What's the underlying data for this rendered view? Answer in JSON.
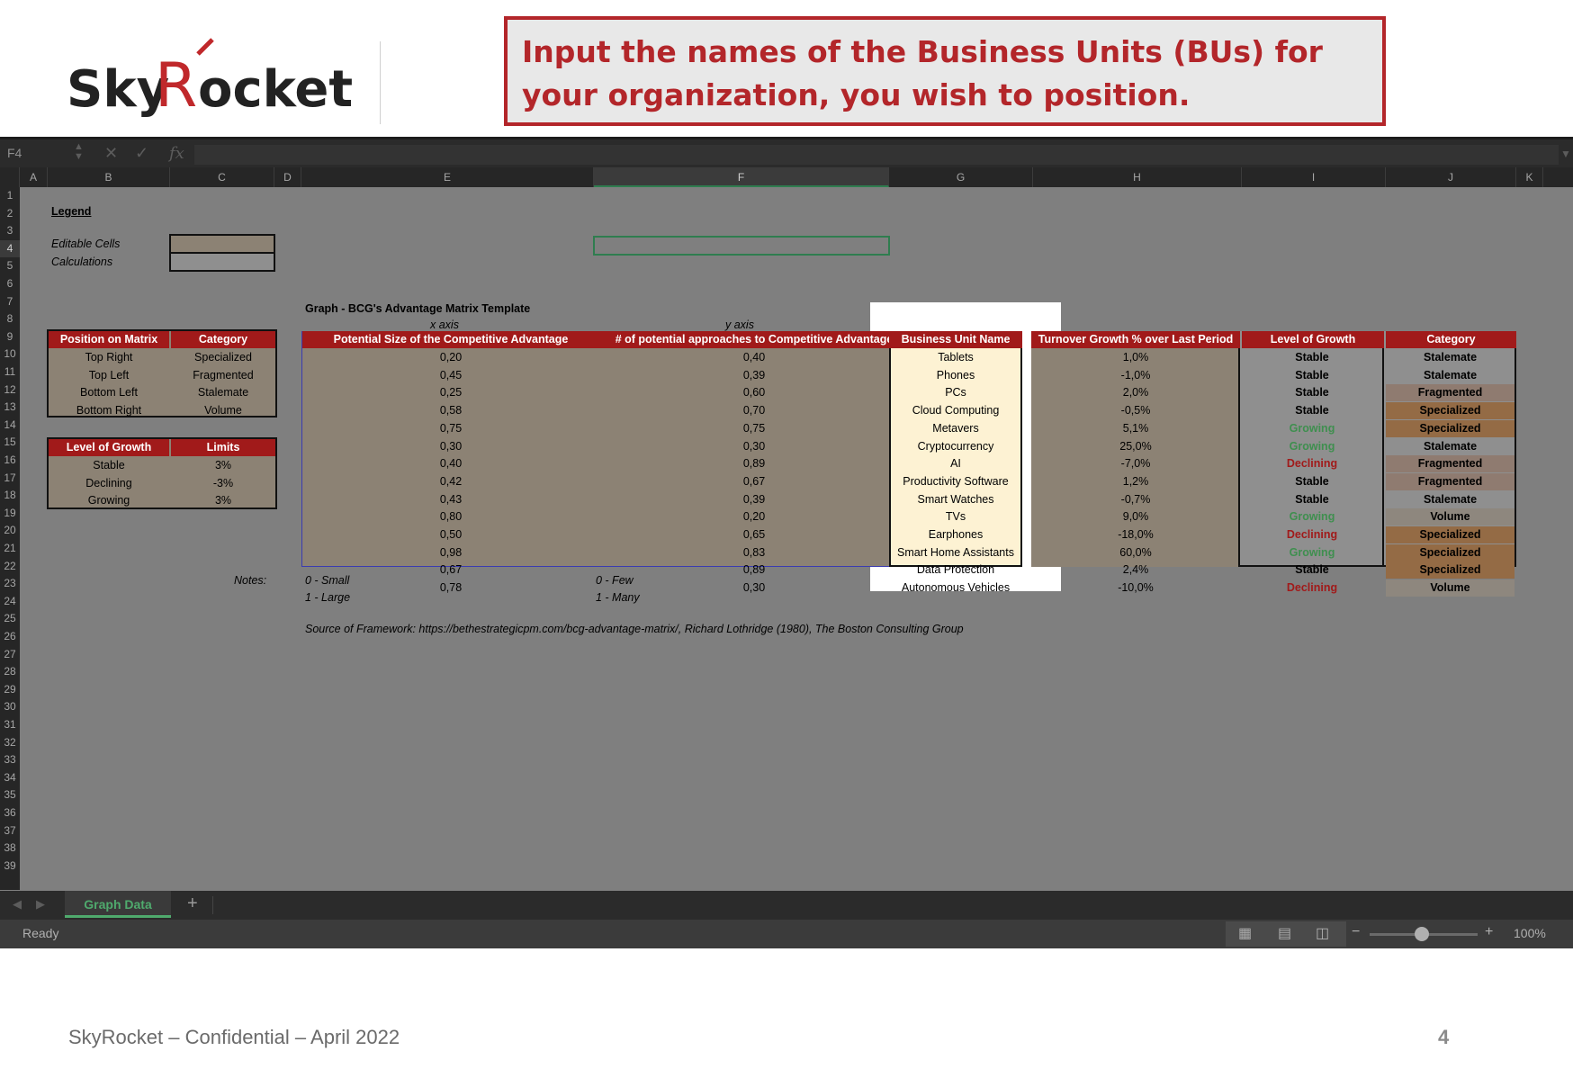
{
  "header": {
    "logo_text": "SkyRocket",
    "callout": "Input the names of the Business Units (BUs) for your organization, you wish to position."
  },
  "formula_bar": {
    "name_box": "F4",
    "cancel_icon": "close-icon",
    "enter_icon": "checkmark-icon",
    "function_icon": "fx-icon"
  },
  "columns": [
    "A",
    "B",
    "C",
    "D",
    "E",
    "F",
    "G",
    "H",
    "I",
    "J",
    "K"
  ],
  "rows": [
    "1",
    "2",
    "3",
    "4",
    "5",
    "6",
    "7",
    "8",
    "9",
    "10",
    "11",
    "12",
    "13",
    "14",
    "15",
    "16",
    "17",
    "18",
    "19",
    "20",
    "21",
    "22",
    "23",
    "24",
    "25",
    "26",
    "27",
    "28",
    "29",
    "30",
    "31",
    "32",
    "33",
    "34",
    "35",
    "36",
    "37",
    "38",
    "39"
  ],
  "legend": {
    "title": "Legend",
    "editable": "Editable Cells",
    "calculations": "Calculations"
  },
  "position_table": {
    "headers": [
      "Position on Matrix",
      "Category"
    ],
    "rows": [
      [
        "Top Right",
        "Specialized"
      ],
      [
        "Top Left",
        "Fragmented"
      ],
      [
        "Bottom Left",
        "Stalemate"
      ],
      [
        "Bottom Right",
        "Volume"
      ]
    ]
  },
  "growth_table": {
    "headers": [
      "Level of Growth",
      "Limits"
    ],
    "rows": [
      [
        "Stable",
        "3%"
      ],
      [
        "Declining",
        "-3%"
      ],
      [
        "Growing",
        "3%"
      ]
    ]
  },
  "graph": {
    "title": "Graph - BCG's Advantage Matrix Template",
    "x_axis_label": "x axis",
    "y_axis_label": "y axis",
    "headers": [
      "Potential Size of the Competitive Advantage",
      "# of potential approaches to Competitive Advantage",
      "Business Unit Name",
      "Turnover Growth % over Last Period",
      "Level of Growth",
      "Category"
    ],
    "rows": [
      {
        "x": "0,20",
        "y": "0,40",
        "name": "Tablets",
        "growth": "1,0%",
        "level": "Stable",
        "category": "Stalemate"
      },
      {
        "x": "0,45",
        "y": "0,39",
        "name": "Phones",
        "growth": "-1,0%",
        "level": "Stable",
        "category": "Stalemate"
      },
      {
        "x": "0,25",
        "y": "0,60",
        "name": "PCs",
        "growth": "2,0%",
        "level": "Stable",
        "category": "Fragmented"
      },
      {
        "x": "0,58",
        "y": "0,70",
        "name": "Cloud Computing",
        "growth": "-0,5%",
        "level": "Stable",
        "category": "Specialized"
      },
      {
        "x": "0,75",
        "y": "0,75",
        "name": "Metavers",
        "growth": "5,1%",
        "level": "Growing",
        "category": "Specialized"
      },
      {
        "x": "0,30",
        "y": "0,30",
        "name": "Cryptocurrency",
        "growth": "25,0%",
        "level": "Growing",
        "category": "Stalemate"
      },
      {
        "x": "0,40",
        "y": "0,89",
        "name": "AI",
        "growth": "-7,0%",
        "level": "Declining",
        "category": "Fragmented"
      },
      {
        "x": "0,42",
        "y": "0,67",
        "name": "Productivity Software",
        "growth": "1,2%",
        "level": "Stable",
        "category": "Fragmented"
      },
      {
        "x": "0,43",
        "y": "0,39",
        "name": "Smart Watches",
        "growth": "-0,7%",
        "level": "Stable",
        "category": "Stalemate"
      },
      {
        "x": "0,80",
        "y": "0,20",
        "name": "TVs",
        "growth": "9,0%",
        "level": "Growing",
        "category": "Volume"
      },
      {
        "x": "0,50",
        "y": "0,65",
        "name": "Earphones",
        "growth": "-18,0%",
        "level": "Declining",
        "category": "Specialized"
      },
      {
        "x": "0,98",
        "y": "0,83",
        "name": "Smart Home Assistants",
        "growth": "60,0%",
        "level": "Growing",
        "category": "Specialized"
      },
      {
        "x": "0,67",
        "y": "0,89",
        "name": "Data Protection",
        "growth": "2,4%",
        "level": "Stable",
        "category": "Specialized"
      },
      {
        "x": "0,78",
        "y": "0,30",
        "name": "Autonomous Vehicles",
        "growth": "-10,0%",
        "level": "Declining",
        "category": "Volume"
      }
    ]
  },
  "notes": {
    "label": "Notes:",
    "x_small": "0 - Small",
    "x_large": "1 - Large",
    "y_few": "0 - Few",
    "y_many": "1 - Many",
    "source": "Source of Framework: https://bethestrategicpm.com/bcg-advantage-matrix/, Richard Lothridge (1980), The Boston Consulting Group"
  },
  "colors": {
    "header_red": "#a11a1a",
    "editable": "#8c8274",
    "growing": "#3f8f4f",
    "declining": "#a11a1a",
    "specialized_bg": "#946b45",
    "fragmented_bg": "#8f7b70",
    "stalemate_bg": "#8f8f8f",
    "volume_bg": "#8e877e",
    "highlight": "#fdf2d3"
  },
  "sheet_tabs": {
    "active": "Graph Data",
    "add": "+"
  },
  "status": {
    "ready": "Ready",
    "zoom": "100%"
  },
  "footer": {
    "left": "SkyRocket – Confidential – April 2022",
    "page": "4"
  }
}
